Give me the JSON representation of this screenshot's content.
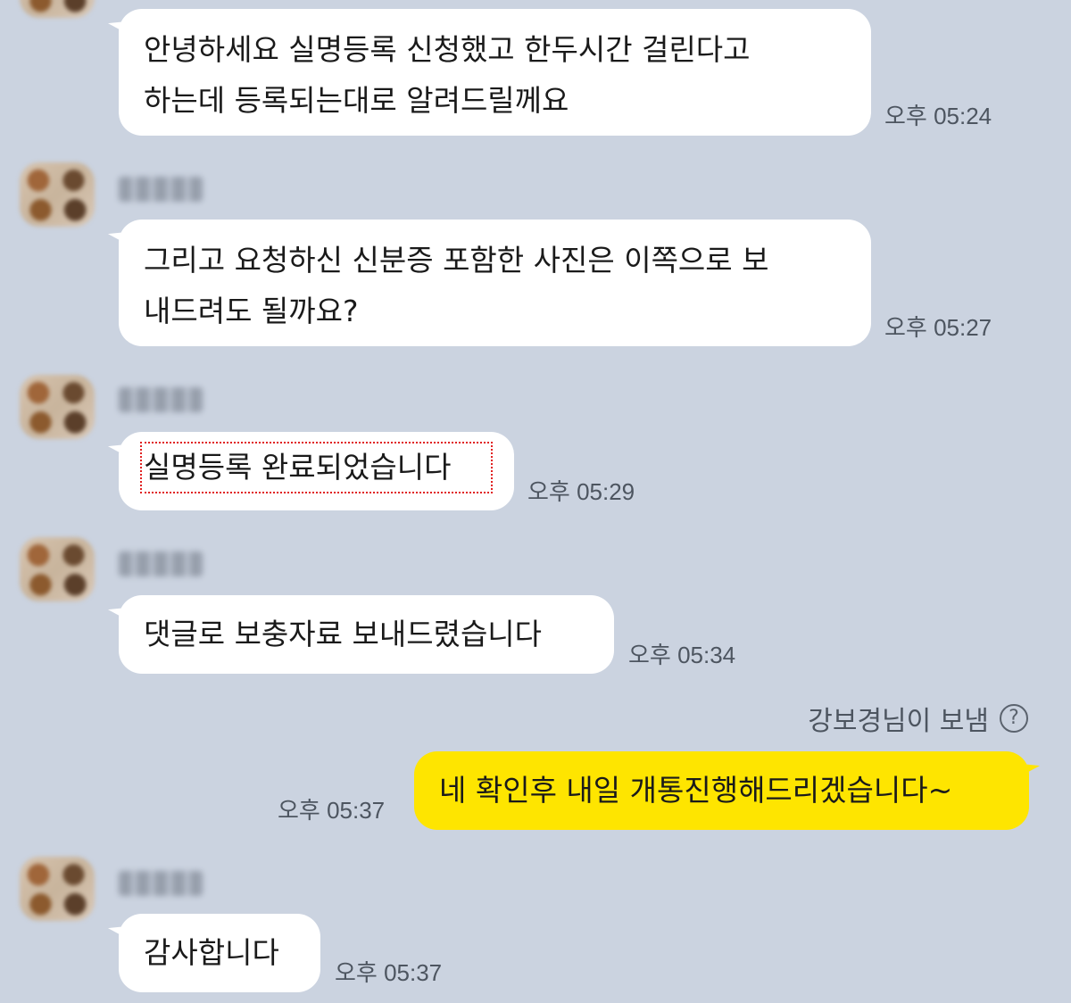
{
  "messages": [
    {
      "lines": [
        "안녕하세요 실명등록 신청했고 한두시간 걸린다고",
        "하는데 등록되는대로 알려드릴께요"
      ],
      "time": "오후 05:24"
    },
    {
      "lines": [
        "그리고 요청하신 신분증 포함한 사진은 이쪽으로 보",
        "내드려도 될까요?"
      ],
      "time": "오후 05:27"
    },
    {
      "lines": [
        "실명등록 완료되었습니다"
      ],
      "time": "오후 05:29"
    },
    {
      "lines": [
        "댓글로 보충자료 보내드렸습니다"
      ],
      "time": "오후 05:34"
    },
    {
      "sent_by": "강보경님이 보냄",
      "help_glyph": "?",
      "lines": [
        "네 확인후 내일 개통진행해드리겠습니다~"
      ],
      "time": "오후 05:37"
    },
    {
      "lines": [
        "감사합니다"
      ],
      "time": "오후 05:37"
    }
  ],
  "colors": {
    "background": "#cbd3e0",
    "incoming_bubble": "#ffffff",
    "outgoing_bubble": "#fee500",
    "highlight_outline": "#e02020"
  },
  "icons": [
    "avatar",
    "help-icon"
  ]
}
